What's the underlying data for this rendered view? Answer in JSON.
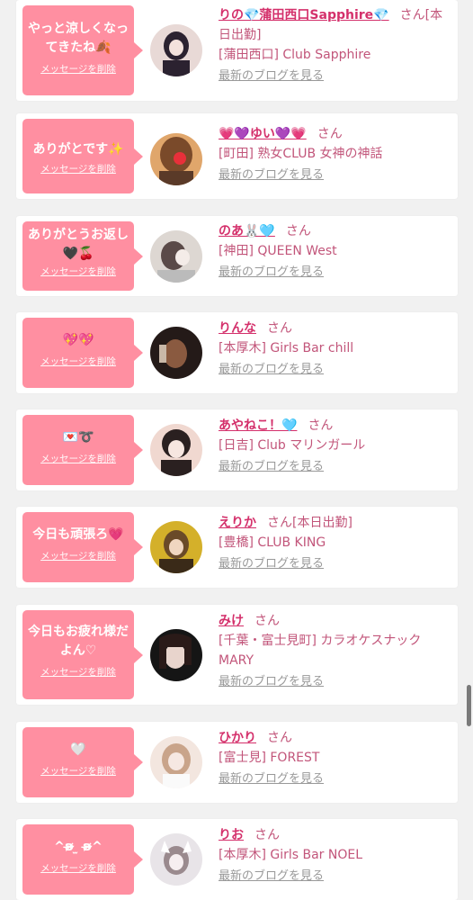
{
  "cards": [
    {
      "message": "やっと涼しくなってきたね🍂",
      "delete_label": "メッセージを削除",
      "name": "りの💎蒲田西口Sapphire💎",
      "san": "さん",
      "extra": "[本日出勤]",
      "shop": "[蒲田西口] Club Sapphire",
      "blog_label": "最新のブログを見る",
      "avatar_colors": [
        "#2b2230",
        "#e8d9d6"
      ]
    },
    {
      "message": "ありがとです✨",
      "delete_label": "メッセージを削除",
      "name": "💗💜ゆい💜💗",
      "san": "さん",
      "extra": "",
      "shop": "[町田] 熟女CLUB 女神の神話",
      "blog_label": "最新のブログを見る",
      "avatar_colors": [
        "#7a4a2a",
        "#e0a66b"
      ]
    },
    {
      "message": "ありがとうお返し🖤🍒",
      "delete_label": "メッセージを削除",
      "name": "のあ🐰🩵",
      "san": "さん",
      "extra": "",
      "shop": "[神田] QUEEN West",
      "blog_label": "最新のブログを見る",
      "avatar_colors": [
        "#ddd7d2",
        "#5a4a48"
      ]
    },
    {
      "message": "💖💖",
      "delete_label": "メッセージを削除",
      "name": "りんな",
      "san": "さん",
      "extra": "",
      "shop": "[本厚木] Girls Bar chill",
      "blog_label": "最新のブログを見る",
      "avatar_colors": [
        "#241a18",
        "#8a5a40"
      ]
    },
    {
      "message": "💌➰",
      "delete_label": "メッセージを削除",
      "name": "あやねこ！🩵",
      "san": "さん",
      "extra": "",
      "shop": "[日吉] Club マリンガール",
      "blog_label": "最新のブログを見る",
      "avatar_colors": [
        "#2a2020",
        "#f0d8d0"
      ]
    },
    {
      "message": "今日も頑張ろ💗",
      "delete_label": "メッセージを削除",
      "name": "えりか",
      "san": "さん",
      "extra": "[本日出勤]",
      "shop": "[豊橋] CLUB KING",
      "blog_label": "最新のブログを見る",
      "avatar_colors": [
        "#d4b02a",
        "#3a2a18"
      ]
    },
    {
      "message": "今日もお疲れ様だよん♡",
      "delete_label": "メッセージを削除",
      "name": "みけ",
      "san": "さん",
      "extra": "",
      "shop": "[千葉・富士見町] カラオケスナック MARY",
      "blog_label": "最新のブログを見る",
      "avatar_colors": [
        "#151515",
        "#6a4a44"
      ]
    },
    {
      "message": "🤍",
      "delete_label": "メッセージを削除",
      "name": "ひかり",
      "san": "さん",
      "extra": "",
      "shop": "[富士見] FOREST",
      "blog_label": "最新のブログを見る",
      "avatar_colors": [
        "#c9a48a",
        "#f3e6df"
      ]
    },
    {
      "message": "^ʚ̴̶̷̷ ̫ ʚ̴̶̷̷^",
      "delete_label": "メッセージを削除",
      "name": "りお",
      "san": "さん",
      "extra": "",
      "shop": "[本厚木] Girls Bar NOEL",
      "blog_label": "最新のブログを見る",
      "avatar_colors": [
        "#e8e4e8",
        "#9a8a8e"
      ]
    }
  ]
}
